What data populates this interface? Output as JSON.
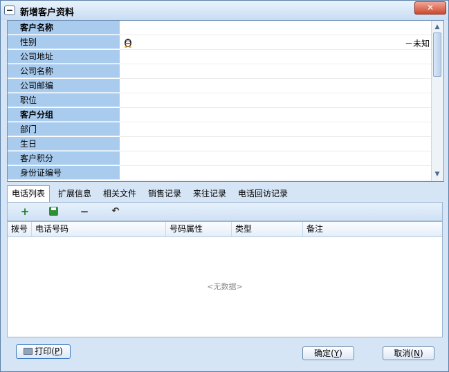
{
  "window": {
    "title": "新增客户资料",
    "close_label": "✕"
  },
  "fields": [
    {
      "label": "客户名称",
      "bold": true,
      "value": ""
    },
    {
      "label": "性别",
      "bold": false,
      "value": "",
      "icon": "qq-penguin-icon",
      "extra": "－未知"
    },
    {
      "label": "公司地址",
      "bold": false,
      "value": ""
    },
    {
      "label": "公司名称",
      "bold": false,
      "value": ""
    },
    {
      "label": "公司邮编",
      "bold": false,
      "value": ""
    },
    {
      "label": "职位",
      "bold": false,
      "value": ""
    },
    {
      "label": "客户分组",
      "bold": true,
      "value": ""
    },
    {
      "label": "部门",
      "bold": false,
      "value": ""
    },
    {
      "label": "生日",
      "bold": false,
      "value": ""
    },
    {
      "label": "客户积分",
      "bold": false,
      "value": ""
    },
    {
      "label": "身份证编号",
      "bold": false,
      "value": ""
    }
  ],
  "tabs": [
    "电话列表",
    "扩展信息",
    "相关文件",
    "销售记录",
    "来往记录",
    "电话回访记录"
  ],
  "toolbar": {
    "add": "+",
    "save": "save-icon",
    "remove": "−",
    "undo": "↶"
  },
  "table": {
    "columns": [
      "拨号",
      "电话号码",
      "号码属性",
      "类型",
      "备注"
    ],
    "rows": [],
    "empty_text": "<无数据>"
  },
  "buttons": {
    "print": "打印(P)",
    "print_parts": {
      "text": "打印(",
      "key": "P",
      "end": ")"
    },
    "ok_parts": {
      "text": "确定(",
      "key": "Y",
      "end": ")"
    },
    "cancel_parts": {
      "text": "取消(",
      "key": "N",
      "end": ")"
    }
  },
  "colors": {
    "label_bg": "#a9cbee",
    "window_bg": "#d6e5f5",
    "border": "#6d8fb5"
  }
}
